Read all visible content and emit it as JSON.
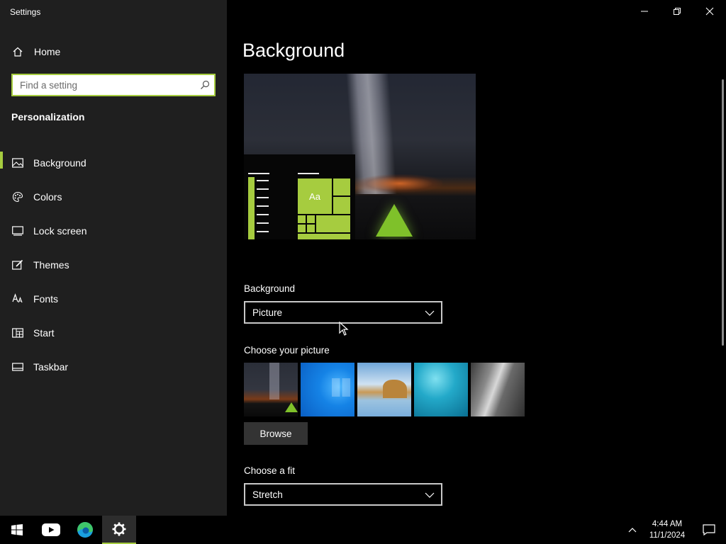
{
  "window": {
    "title": "Settings"
  },
  "sidebar": {
    "home_label": "Home",
    "search_placeholder": "Find a setting",
    "section_title": "Personalization",
    "items": [
      {
        "label": "Background",
        "icon": "picture-icon",
        "active": true
      },
      {
        "label": "Colors",
        "icon": "palette-icon",
        "active": false
      },
      {
        "label": "Lock screen",
        "icon": "lock-screen-icon",
        "active": false
      },
      {
        "label": "Themes",
        "icon": "themes-brush-icon",
        "active": false
      },
      {
        "label": "Fonts",
        "icon": "fonts-icon",
        "active": false
      },
      {
        "label": "Start",
        "icon": "start-layout-icon",
        "active": false
      },
      {
        "label": "Taskbar",
        "icon": "taskbar-icon",
        "active": false
      }
    ]
  },
  "main": {
    "title": "Background",
    "preview": {
      "tile_text": "Aa"
    },
    "background_label": "Background",
    "background_value": "Picture",
    "choose_picture_label": "Choose your picture",
    "browse_label": "Browse",
    "fit_label": "Choose a fit",
    "fit_value": "Stretch"
  },
  "taskbar": {
    "apps": [
      "windows-start-icon",
      "youtube-icon",
      "edge-icon",
      "settings-gear-icon"
    ],
    "time": "4:44 AM",
    "date": "11/1/2024"
  },
  "colors": {
    "accent": "#a6cc3f",
    "sidebar_bg": "#1f1f1f",
    "main_bg": "#000000"
  }
}
